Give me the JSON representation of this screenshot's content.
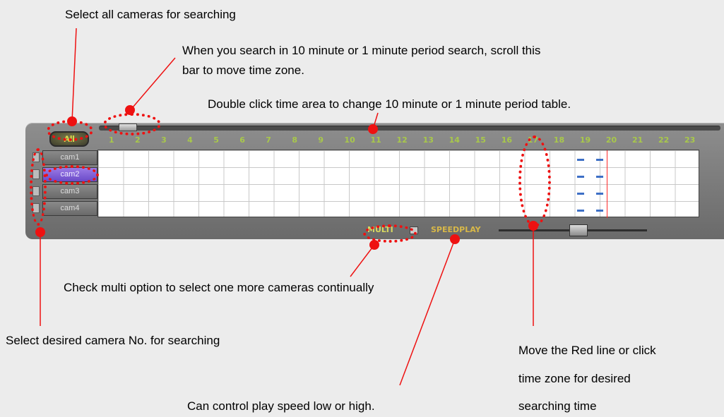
{
  "annotations": {
    "select_all": "Select all cameras  for searching",
    "scroll_line1": "When you search in 10 minute or 1 minute period  search, scroll this",
    "scroll_line2": "bar to move time zone.",
    "double_click": "Double click time area to change 10 minute or 1 minute period table.",
    "multi_option": "Check multi option to select one more cameras continually",
    "select_camera": "Select desired camera No. for searching",
    "play_speed": "Can control play speed low or high.",
    "red_line_1": "Move the Red line or click",
    "red_line_2": "time zone for desired",
    "red_line_3": "searching time"
  },
  "panel": {
    "all_label": "All",
    "hours": [
      "1",
      "2",
      "3",
      "4",
      "5",
      "6",
      "7",
      "8",
      "9",
      "10",
      "11",
      "12",
      "13",
      "14",
      "15",
      "16",
      "17",
      "18",
      "19",
      "20",
      "21",
      "22",
      "23"
    ],
    "cameras": [
      {
        "label": "cam1",
        "selected": false
      },
      {
        "label": "cam2",
        "selected": true
      },
      {
        "label": "cam3",
        "selected": false
      },
      {
        "label": "cam4",
        "selected": false
      }
    ],
    "multi_label": "MULTI",
    "speed_label": "SPEEDPLAY"
  },
  "colors": {
    "callout": "#ee1111",
    "record_mark": "#3d6fc6",
    "time_cursor": "#ff2a2a",
    "hour_text": "#a8c84a",
    "selected_cam": "#7a5ad8"
  }
}
